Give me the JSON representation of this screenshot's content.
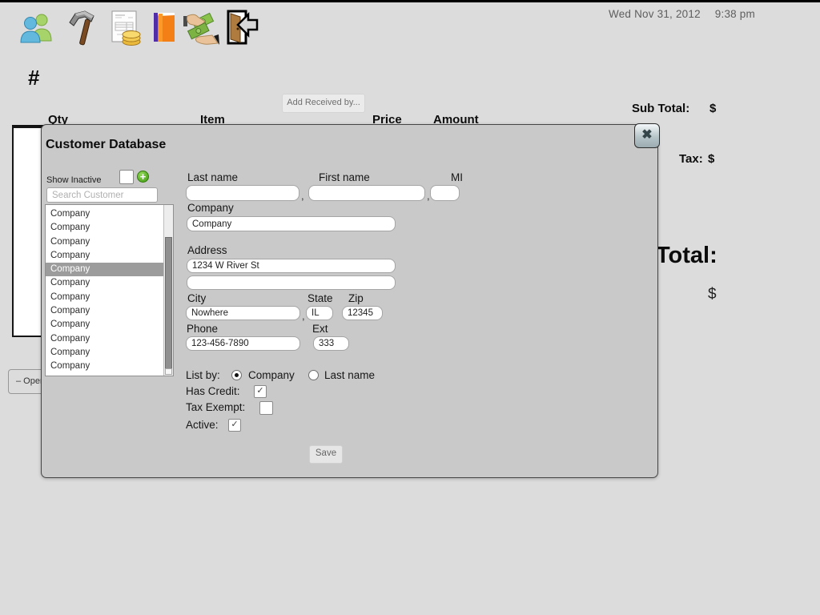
{
  "icons": {
    "close": "✖",
    "plus": "+",
    "check": "✓"
  },
  "topbar": {
    "date": "Wed Nov 31, 2012",
    "time": "9:38 pm"
  },
  "ticket": {
    "number_label": "#",
    "add_received_button": "Add Received by...",
    "columns": [
      "Qty",
      "Item",
      "Price",
      "Amount"
    ],
    "subtotal_label": "Sub Total:",
    "subtotal_value": "$",
    "tax_label": "Tax:",
    "tax_value": "$",
    "total_label": "Total:",
    "total_value": "$",
    "open_button_label": "– Oper"
  },
  "dialog": {
    "title": "Customer Database",
    "show_inactive_label": "Show Inactive",
    "search_placeholder": "Search Customer",
    "comma": ",",
    "customer_list": {
      "items": [
        "Company",
        "Company",
        "Company",
        "Company",
        "Company",
        "Company",
        "Company",
        "Company",
        "Company",
        "Company",
        "Company",
        "Company"
      ],
      "selected_index": 4
    },
    "fields": {
      "last_name_label": "Last name",
      "last_name_value": "",
      "first_name_label": "First name",
      "first_name_value": "",
      "mi_label": "MI",
      "mi_value": "",
      "company_label": "Company",
      "company_value": "Company",
      "address_label": "Address",
      "address1_value": "1234 W River St",
      "address2_value": "",
      "city_label": "City",
      "city_value": "Nowhere",
      "state_label": "State",
      "state_value": "IL",
      "zip_label": "Zip",
      "zip_value": "12345",
      "phone_label": "Phone",
      "phone_value": "123-456-7890",
      "ext_label": "Ext",
      "ext_value": "333"
    },
    "list_by": {
      "label": "List by:",
      "option1": "Company",
      "option1_selected": true,
      "option2": "Last name",
      "option2_selected": false
    },
    "checks": {
      "has_credit_label": "Has Credit:",
      "has_credit": true,
      "tax_exempt_label": "Tax Exempt:",
      "tax_exempt": false,
      "active_label": "Active:",
      "active": true
    },
    "save_button": "Save"
  }
}
